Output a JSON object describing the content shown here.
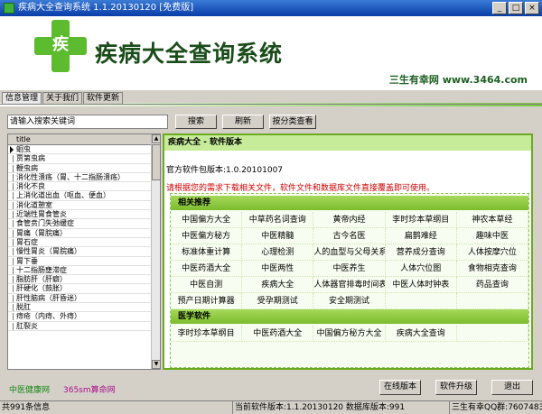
{
  "window": {
    "title": "疾病大全查询系统 1.1.20130120 [免费版]",
    "min": "_",
    "max": "□",
    "close": "×"
  },
  "banner": {
    "logo_char": "疾",
    "app_title": "疾病大全查询系统",
    "slogan": "三生有幸网 www.3464.com"
  },
  "tabs": [
    {
      "label": "信息管理"
    },
    {
      "label": "关于我们"
    },
    {
      "label": "软件更新"
    }
  ],
  "search": {
    "placeholder": "请输入搜索关键词",
    "value": "请输入搜索关键词",
    "search_btn": "搜索",
    "refresh_btn": "刷新",
    "category_btn": "按分类查看"
  },
  "list": {
    "header": "title",
    "rows": [
      "蛔虫",
      "贾第虫病",
      "鞭虫病",
      "消化性溃疡（胃、十二指肠溃疡）",
      "消化不良",
      "上消化道出血（呕血、便血）",
      "消化道憩室",
      "近端性胃食管炎",
      "食管贲门失弛缓症",
      "胃痛（胃脘痛）",
      "胃石症",
      "慢性胃炎（胃脘痛）",
      "胃下垂",
      "十二指肠壅滞症",
      "脂肪肝（肝癖）",
      "肝硬化（鼓胀）",
      "肝性脑病（肝昏迷）",
      "脱肛",
      "痔疮（内痔、外痔）",
      "肛裂炎"
    ],
    "selected": 0
  },
  "content": {
    "header": "疾病大全 - 软件版本",
    "version_line": "官方软件包版本:1.0.20101007",
    "notice": "请根据您的需求下载相关文件，软件文件和数据库文件直接覆盖即可使用。",
    "sections": [
      {
        "title": "相关推荐",
        "items": [
          "中国偏方大全",
          "中草药名词查询",
          "黄帝内经",
          "李时珍本草纲目",
          "神农本草经",
          "中医偏方秘方",
          "中医精髓",
          "古今名医",
          "扁鹊难经",
          "趣味中医",
          "标准体重计算",
          "心理检测",
          "人的血型与父母关系",
          "营养成分查询",
          "人体按摩穴位",
          "中医药酒大全",
          "中医两性",
          "中医养生",
          "人体穴位图",
          "食物相克查询",
          "中医自测",
          "疾病大全",
          "人体器官排毒时间表",
          "中医人体时钟表",
          "药品查询",
          "预产日期计算器",
          "受孕期测试",
          "安全期测试",
          "",
          ""
        ]
      },
      {
        "title": "医学软件",
        "items": [
          "李时珍本草纲目",
          "中医药酒大全",
          "中国偏方秘方大全",
          "疾病大全查询",
          ""
        ]
      }
    ]
  },
  "bottom": {
    "link1": "中医健康网",
    "link2": "365sm算命网",
    "online_btn": "在线版本",
    "upgrade_btn": "软件升级",
    "exit_btn": "退出"
  },
  "status": {
    "count": "共991条信息",
    "version": "当前软件版本:1.1.20130120 数据库版本:991",
    "contact": "三生有幸QQ群:76074837"
  }
}
